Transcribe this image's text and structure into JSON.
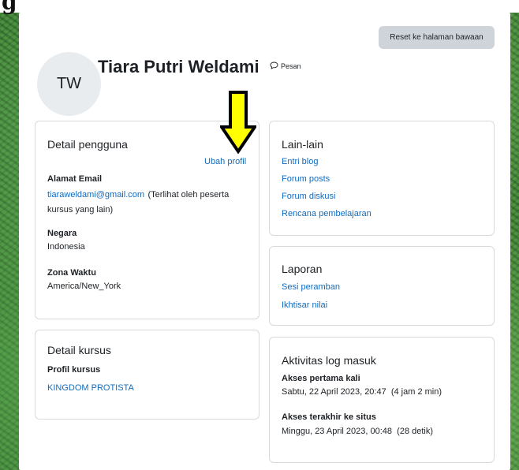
{
  "corner_text": "g",
  "header": {
    "reset_label": "Reset ke halaman bawaan",
    "avatar_initials": "TW",
    "fullname": "Tiara Putri Weldami",
    "message_label": "Pesan"
  },
  "user_details": {
    "title": "Detail pengguna",
    "edit_link": "Ubah profil",
    "email_label": "Alamat Email",
    "email_value": "tiaraweldami@gmail.com",
    "email_note": "(Terlihat oleh peserta kursus yang lain)",
    "country_label": "Negara",
    "country_value": "Indonesia",
    "timezone_label": "Zona Waktu",
    "timezone_value": "America/New_York"
  },
  "course_details": {
    "title": "Detail kursus",
    "profile_label": "Profil kursus",
    "course_link": "KINGDOM PROTISTA"
  },
  "misc": {
    "title": "Lain-lain",
    "links": [
      "Entri blog",
      "Forum posts",
      "Forum diskusi",
      "Rencana pembelajaran"
    ]
  },
  "reports": {
    "title": "Laporan",
    "links": [
      "Sesi peramban",
      "Ikhtisar nilai"
    ]
  },
  "login_activity": {
    "title": "Aktivitas log masuk",
    "first_label": "Akses pertama kali",
    "first_value": "Sabtu, 22 April 2023, 20:47  (4 jam 2 min)",
    "last_label": "Akses terakhir ke situs",
    "last_value": "Minggu, 23 April 2023, 00:48  (28 detik)"
  },
  "colors": {
    "link": "#0f6cbf",
    "arrow_fill": "#ffff00",
    "button_bg": "#ced4da"
  },
  "icons": {
    "message": "speech-bubble-icon",
    "annotation": "down-arrow-icon"
  }
}
